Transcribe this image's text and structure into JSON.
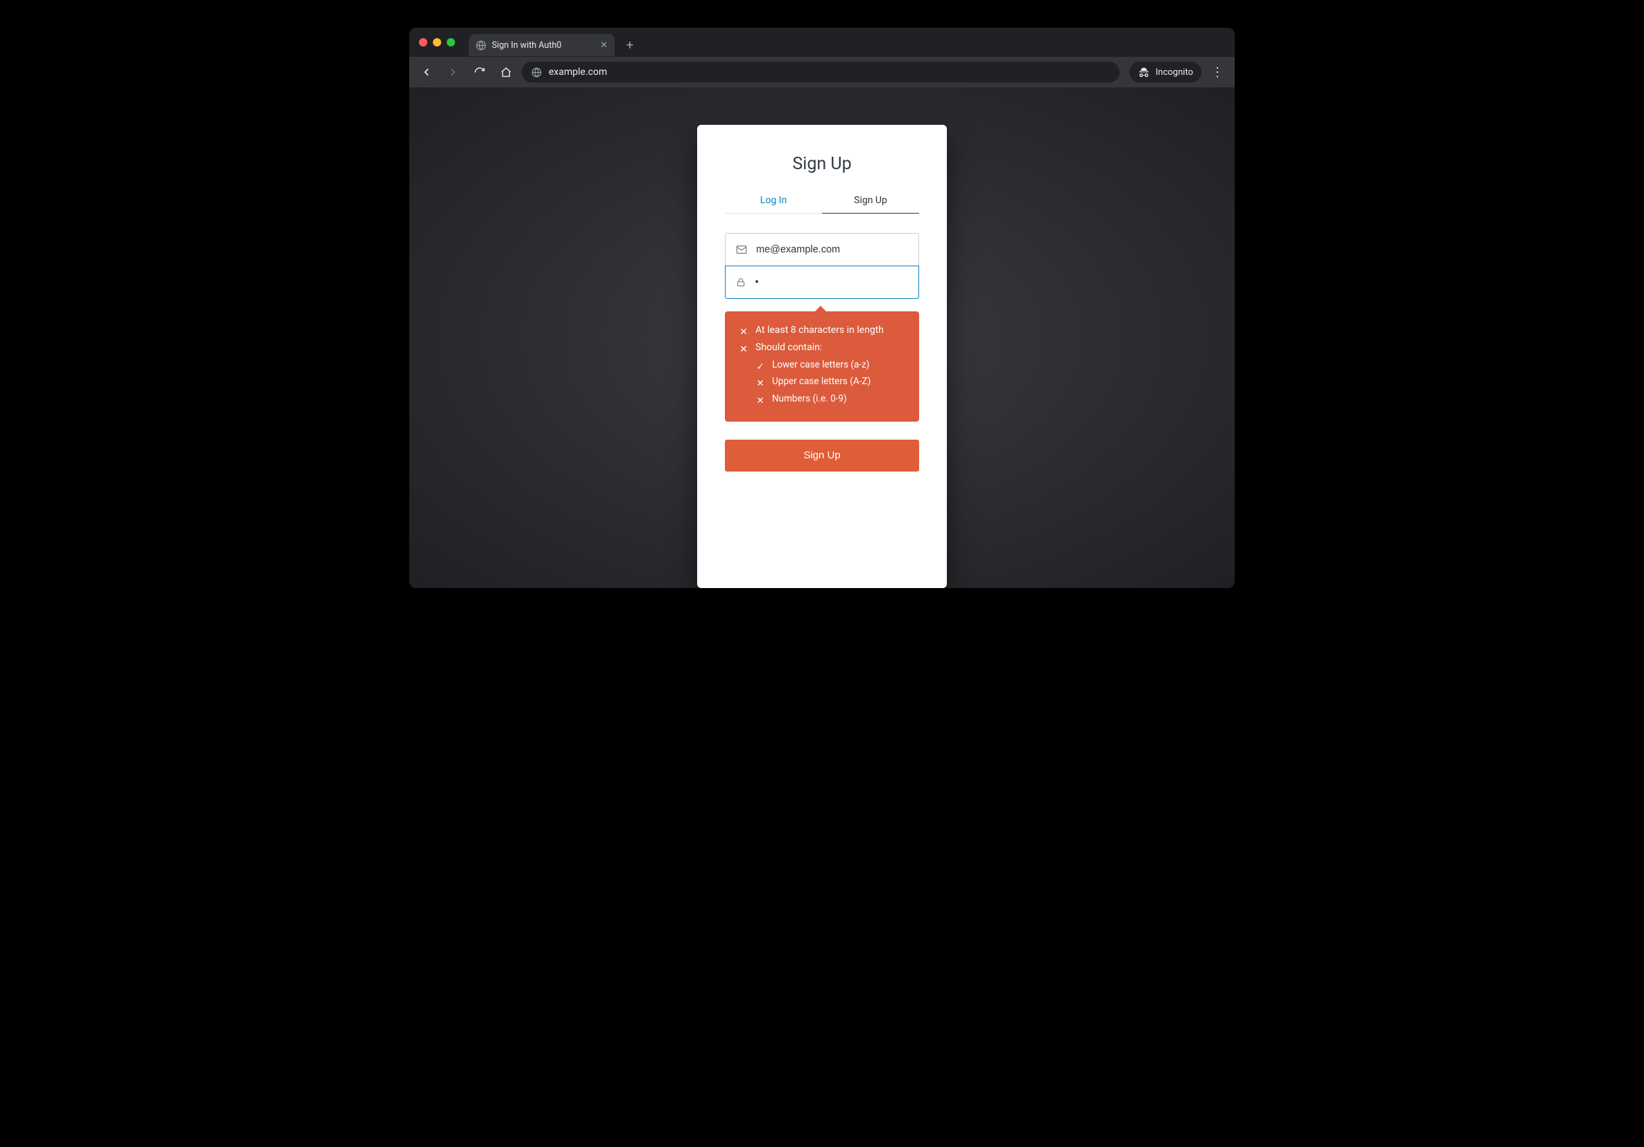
{
  "browser": {
    "tab_title": "Sign In with Auth0",
    "url": "example.com",
    "incognito_label": "Incognito"
  },
  "auth": {
    "title": "Sign Up",
    "tabs": {
      "login": "Log In",
      "signup": "Sign Up"
    },
    "email_value": "me@example.com",
    "password_masked": "•",
    "requirements": {
      "length": "At least 8 characters in length",
      "contain_header": "Should contain:",
      "lower": "Lower case letters (a-z)",
      "upper": "Upper case letters (A-Z)",
      "numbers": "Numbers (i.e. 0-9)"
    },
    "submit_label": "Sign Up"
  }
}
